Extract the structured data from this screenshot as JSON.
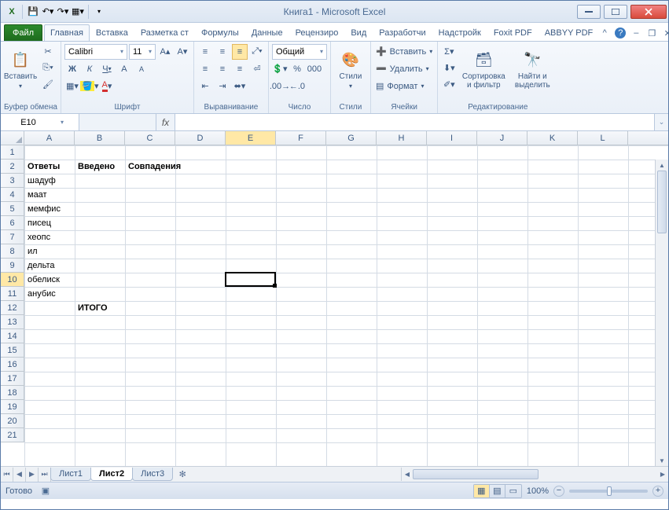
{
  "title": "Книга1  -  Microsoft Excel",
  "tabs": {
    "file": "Файл",
    "items": [
      "Главная",
      "Вставка",
      "Разметка ст",
      "Формулы",
      "Данные",
      "Рецензиро",
      "Вид",
      "Разработчи",
      "Надстройк",
      "Foxit PDF",
      "ABBYY PDF"
    ],
    "active": 0
  },
  "ribbon": {
    "clipboard": {
      "paste": "Вставить",
      "label": "Буфер обмена"
    },
    "font": {
      "name": "Calibri",
      "size": "11",
      "label": "Шрифт"
    },
    "align": {
      "label": "Выравнивание"
    },
    "number": {
      "format": "Общий",
      "label": "Число"
    },
    "styles": {
      "styles": "Стили",
      "label": "Стили"
    },
    "cells": {
      "insert": "Вставить",
      "delete": "Удалить",
      "format": "Формат",
      "label": "Ячейки"
    },
    "editing": {
      "sort": "Сортировка\nи фильтр",
      "find": "Найти и\nвыделить",
      "label": "Редактирование"
    }
  },
  "namebox": "E10",
  "columns": [
    "A",
    "B",
    "C",
    "D",
    "E",
    "F",
    "G",
    "H",
    "I",
    "J",
    "K",
    "L"
  ],
  "rows": 21,
  "sel": {
    "col": 4,
    "row": 9
  },
  "cells": [
    {
      "r": 1,
      "c": 0,
      "v": "Ответы",
      "b": true
    },
    {
      "r": 1,
      "c": 1,
      "v": "Введено",
      "b": true
    },
    {
      "r": 1,
      "c": 2,
      "v": "Совпадения",
      "b": true
    },
    {
      "r": 2,
      "c": 0,
      "v": "шадуф"
    },
    {
      "r": 3,
      "c": 0,
      "v": "маат"
    },
    {
      "r": 4,
      "c": 0,
      "v": "мемфис"
    },
    {
      "r": 5,
      "c": 0,
      "v": "писец"
    },
    {
      "r": 6,
      "c": 0,
      "v": "хеопс"
    },
    {
      "r": 7,
      "c": 0,
      "v": "ил"
    },
    {
      "r": 8,
      "c": 0,
      "v": "дельта"
    },
    {
      "r": 9,
      "c": 0,
      "v": "обелиск"
    },
    {
      "r": 10,
      "c": 0,
      "v": "анубис"
    },
    {
      "r": 11,
      "c": 1,
      "v": "ИТОГО",
      "b": true
    }
  ],
  "sheets": {
    "items": [
      "Лист1",
      "Лист2",
      "Лист3"
    ],
    "active": 1
  },
  "status": {
    "ready": "Готово",
    "zoom": "100%"
  }
}
